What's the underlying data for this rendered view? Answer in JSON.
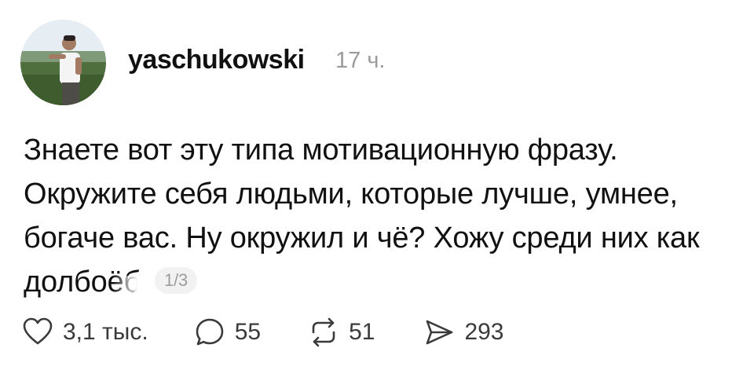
{
  "post": {
    "username": "yaschukowski",
    "time": "17 ч.",
    "text_lines": [
      "Знаете вот эту типа мотивационную фразу.",
      "Окружите себя людьми, которые лучше, умнее,",
      "богаче вас. Ну окружил и чё? Хожу среди них как",
      "долбоёб"
    ],
    "page_indicator": "1/3"
  },
  "actions": {
    "likes": "3,1 тыс.",
    "comments": "55",
    "reposts": "51",
    "shares": "293"
  },
  "icons": {
    "like": "heart-icon",
    "comment": "comment-bubble-icon",
    "repost": "repost-icon",
    "share": "send-icon"
  }
}
